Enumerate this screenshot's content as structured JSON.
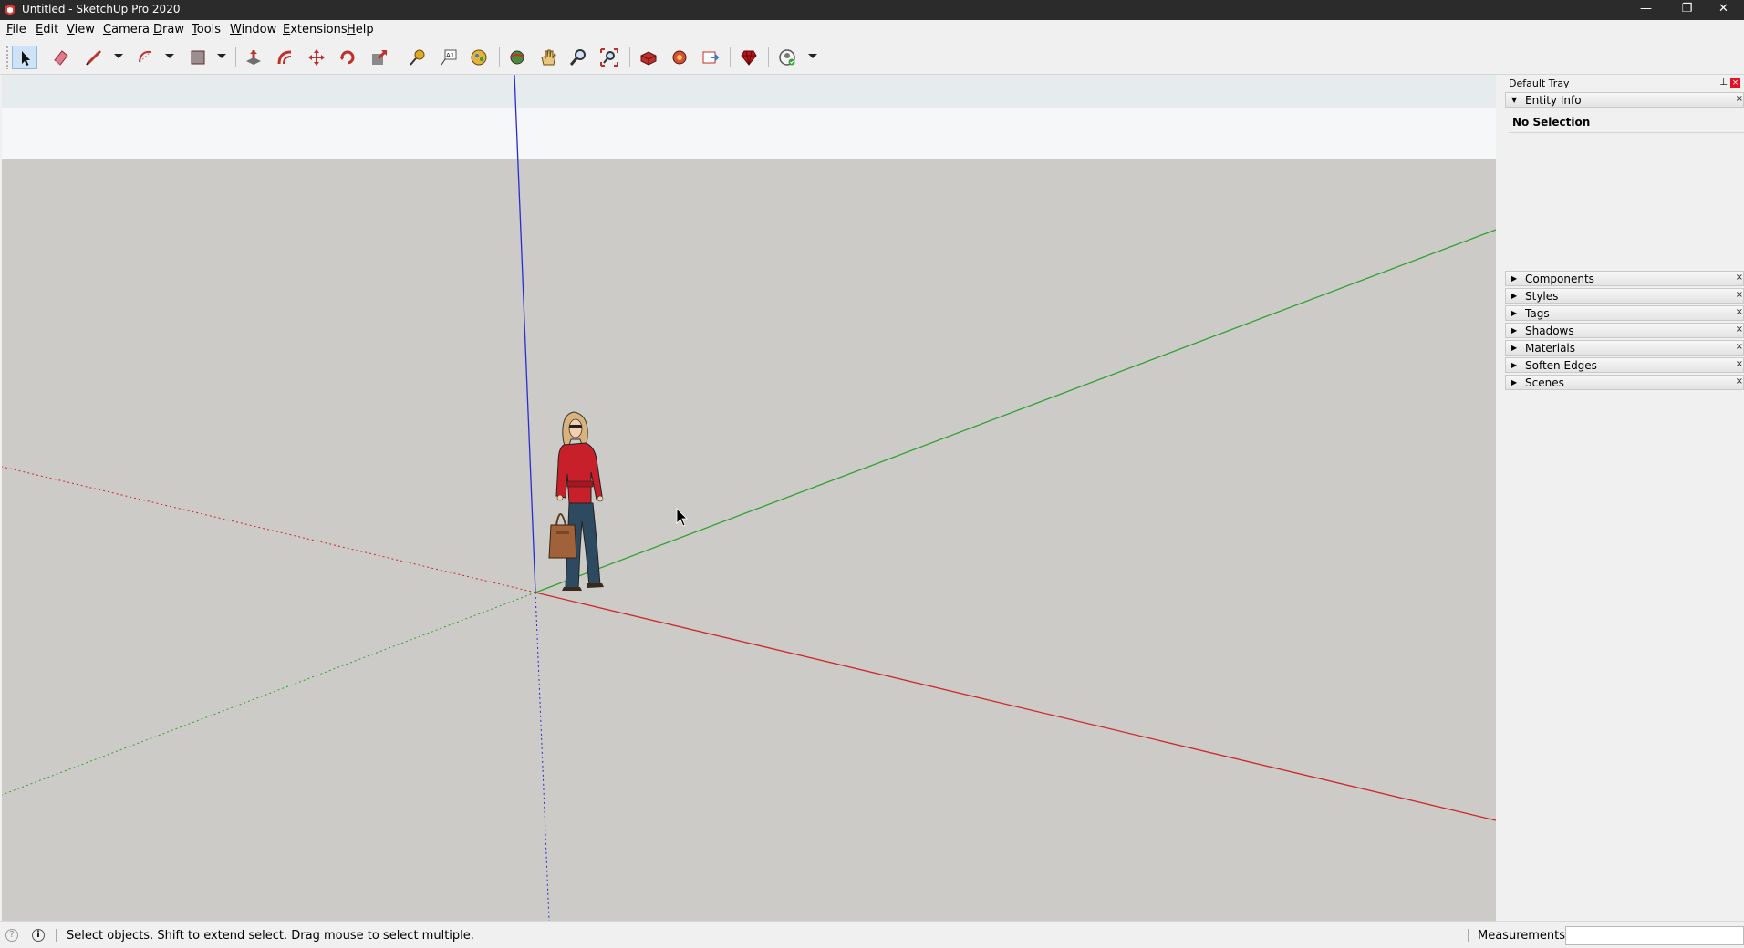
{
  "window": {
    "title": "Untitled - SketchUp Pro 2020",
    "minimize_glyph": "—",
    "restore_glyph": "❐",
    "close_glyph": "✕"
  },
  "menu": [
    {
      "label": "File"
    },
    {
      "label": "Edit"
    },
    {
      "label": "View"
    },
    {
      "label": "Camera"
    },
    {
      "label": "Draw"
    },
    {
      "label": "Tools"
    },
    {
      "label": "Window"
    },
    {
      "label": "Extensions"
    },
    {
      "label": "Help"
    }
  ],
  "toolbar": {
    "icons": [
      "select-icon",
      "eraser-icon",
      "line-icon",
      "arc-icon",
      "rectangle-icon",
      "push-pull-icon",
      "offset-icon",
      "move-icon",
      "rotate-icon",
      "scale-icon",
      "tape-measure-icon",
      "text-icon",
      "paint-bucket-icon",
      "orbit-icon",
      "pan-icon",
      "zoom-icon",
      "zoom-extents-icon",
      "3d-warehouse-icon",
      "extension-warehouse-icon",
      "layout-icon",
      "extension-manager-icon",
      "account-icon"
    ],
    "active_tool": "select"
  },
  "viewport": {
    "background_color": "#cccbc7",
    "axis_colors": {
      "red": "#d0262b",
      "green": "#2fa12f",
      "blue": "#2b2bd4"
    }
  },
  "tray": {
    "title": "Default Tray",
    "pin_glyph": "⊥",
    "close_glyph": "×",
    "entity_info": {
      "label": "Entity Info",
      "expanded": true,
      "content": "No Selection"
    },
    "panels": [
      {
        "label": "Components"
      },
      {
        "label": "Styles"
      },
      {
        "label": "Tags"
      },
      {
        "label": "Shadows"
      },
      {
        "label": "Materials"
      },
      {
        "label": "Soften Edges"
      },
      {
        "label": "Scenes"
      }
    ],
    "expanded_arrow": "▼",
    "collapsed_arrow": "▶",
    "panel_close_glyph": "×"
  },
  "status": {
    "help_icon": "?",
    "info_icon": "i",
    "message": "Select objects. Shift to extend select. Drag mouse to select multiple.",
    "measurements_label": "Measurements",
    "measurements_value": ""
  }
}
